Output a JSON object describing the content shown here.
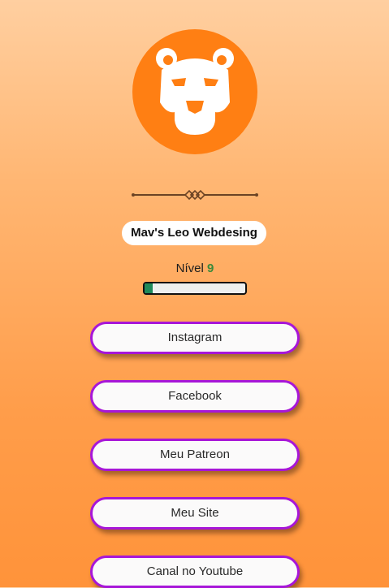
{
  "profile": {
    "name": "Mav's Leo Webdesing",
    "avatar_icon": "lion-icon",
    "avatar_color": "#ff7f13"
  },
  "level": {
    "label": "Nível",
    "value": "9",
    "progress_fraction": 0.08
  },
  "links": [
    {
      "label": "Instagram"
    },
    {
      "label": "Facebook"
    },
    {
      "label": "Meu Patreon"
    },
    {
      "label": "Meu Site"
    },
    {
      "label": "Canal no Youtube"
    }
  ],
  "colors": {
    "button_border": "#a716d8",
    "progress_fill": "#1f8a5a",
    "level_number": "#3b8a3a"
  }
}
